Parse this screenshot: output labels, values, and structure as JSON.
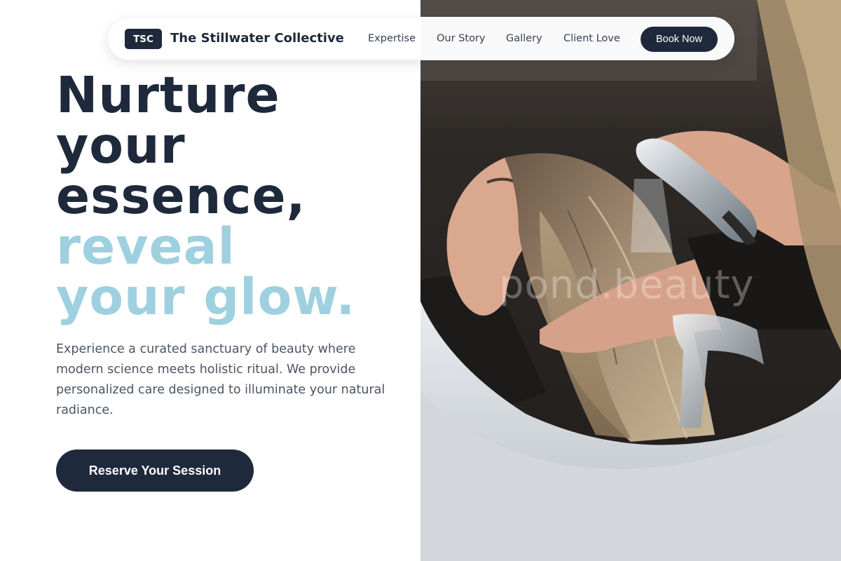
{
  "brand": {
    "badge": "TSC",
    "name": "The Stillwater Collective"
  },
  "nav": {
    "links": [
      "Expertise",
      "Our Story",
      "Gallery",
      "Client Love"
    ],
    "book_label": "Book Now"
  },
  "hero": {
    "headline_lines": [
      "Nurture",
      "your",
      "essence,"
    ],
    "accent_lines": [
      "reveal",
      "your glow."
    ],
    "description": "Experience a curated sanctuary of beauty where modern science meets holistic ritual. We provide personalized care designed to illuminate your natural radiance.",
    "cta_label": "Reserve Your Session"
  },
  "photo": {
    "watermark": "pond.beauty"
  },
  "colors": {
    "navy": "#1e293b",
    "accent": "#9fd0e0",
    "body_text": "#4b5563"
  }
}
